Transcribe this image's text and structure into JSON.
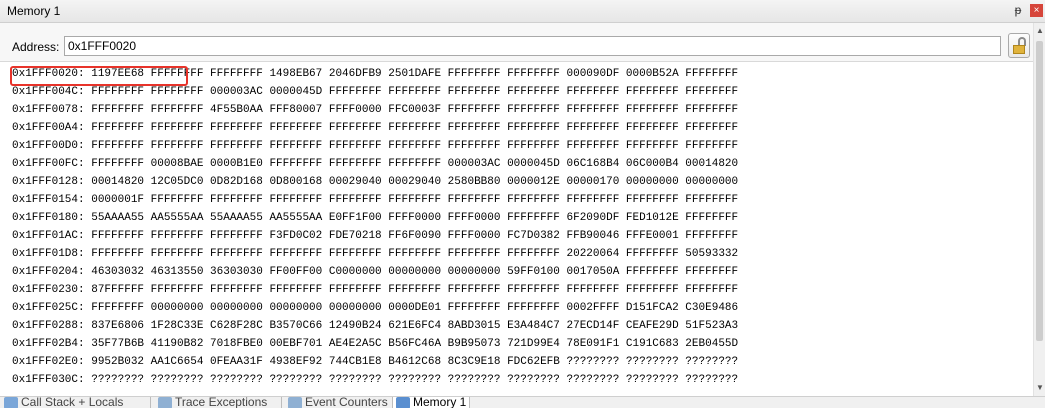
{
  "window": {
    "title": "Memory 1",
    "pin_glyph": "ᵽ",
    "close_glyph": "×"
  },
  "address": {
    "label": "Address:",
    "value": "0x1FFF0020"
  },
  "memory_rows": [
    "0x1FFF0020: 1197EE68 FFFFFFFF FFFFFFFF 1498EB67 2046DFB9 2501DAFE FFFFFFFF FFFFFFFF 000090DF 0000B52A FFFFFFFF",
    "0x1FFF004C: FFFFFFFF FFFFFFFF 000003AC 0000045D FFFFFFFF FFFFFFFF FFFFFFFF FFFFFFFF FFFFFFFF FFFFFFFF FFFFFFFF",
    "0x1FFF0078: FFFFFFFF FFFFFFFF 4F55B0AA FFF80007 FFFF0000 FFC0003F FFFFFFFF FFFFFFFF FFFFFFFF FFFFFFFF FFFFFFFF",
    "0x1FFF00A4: FFFFFFFF FFFFFFFF FFFFFFFF FFFFFFFF FFFFFFFF FFFFFFFF FFFFFFFF FFFFFFFF FFFFFFFF FFFFFFFF FFFFFFFF",
    "0x1FFF00D0: FFFFFFFF FFFFFFFF FFFFFFFF FFFFFFFF FFFFFFFF FFFFFFFF FFFFFFFF FFFFFFFF FFFFFFFF FFFFFFFF FFFFFFFF",
    "0x1FFF00FC: FFFFFFFF 00008BAE 0000B1E0 FFFFFFFF FFFFFFFF FFFFFFFF 000003AC 0000045D 06C168B4 06C000B4 00014820",
    "0x1FFF0128: 00014820 12C05DC0 0D82D168 0D800168 00029040 00029040 2580BB80 0000012E 00000170 00000000 00000000",
    "0x1FFF0154: 0000001F FFFFFFFF FFFFFFFF FFFFFFFF FFFFFFFF FFFFFFFF FFFFFFFF FFFFFFFF FFFFFFFF FFFFFFFF FFFFFFFF",
    "0x1FFF0180: 55AAAA55 AA5555AA 55AAAA55 AA5555AA E0FF1F00 FFFF0000 FFFF0000 FFFFFFFF 6F2090DF FED1012E FFFFFFFF",
    "0x1FFF01AC: FFFFFFFF FFFFFFFF FFFFFFFF F3FD0C02 FDE70218 FF6F0090 FFFF0000 FC7D0382 FFB90046 FFFE0001 FFFFFFFF",
    "0x1FFF01D8: FFFFFFFF FFFFFFFF FFFFFFFF FFFFFFFF FFFFFFFF FFFFFFFF FFFFFFFF FFFFFFFF 20220064 FFFFFFFF 50593332",
    "0x1FFF0204: 46303032 46313550 36303030 FF00FF00 C0000000 00000000 00000000 59FF0100 0017050A FFFFFFFF FFFFFFFF",
    "0x1FFF0230: 87FFFFFF FFFFFFFF FFFFFFFF FFFFFFFF FFFFFFFF FFFFFFFF FFFFFFFF FFFFFFFF FFFFFFFF FFFFFFFF FFFFFFFF",
    "0x1FFF025C: FFFFFFFF 00000000 00000000 00000000 00000000 0000DE01 FFFFFFFF FFFFFFFF 0002FFFF D151FCA2 C30E9486",
    "0x1FFF0288: 837E6806 1F28C33E C628F28C B3570C66 12490B24 621E6FC4 8ABD3015 E3A484C7 27ECD14F CEAFE29D 51F523A3",
    "0x1FFF02B4: 35F77B6B 41190B82 7018FBE0 00EBF701 AE4E2A5C B56FC46A B9B95073 721D99E4 78E091F1 C191C683 2EB0455D",
    "0x1FFF02E0: 9952B032 AA1C6654 0FEAA31F 4938EF92 744CB1E8 B4612C68 8C3C9E18 FDC62EFB ???????? ???????? ????????",
    "0x1FFF030C: ???????? ???????? ???????? ???????? ???????? ???????? ???????? ???????? ???????? ???????? ????????"
  ],
  "tabs": [
    {
      "label": "Call Stack + Locals",
      "icon": "call-stack-icon",
      "active": false
    },
    {
      "label": "Trace Exceptions",
      "icon": "trace-exceptions-icon",
      "active": false
    },
    {
      "label": "Event Counters",
      "icon": "event-counters-icon",
      "active": false
    },
    {
      "label": "Memory 1",
      "icon": "memory-icon",
      "active": true
    }
  ],
  "colors": {
    "highlight_box": "#e8332a",
    "close_button": "#d6453a"
  }
}
